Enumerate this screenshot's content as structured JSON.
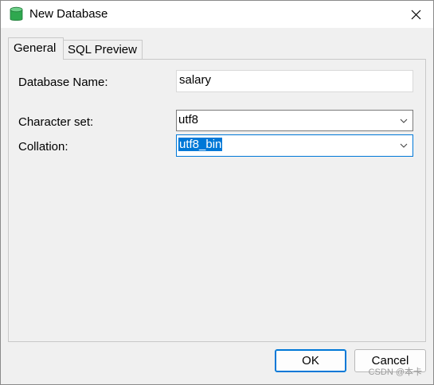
{
  "window": {
    "title": "New Database",
    "icon": "database-icon",
    "close_icon": "close-icon"
  },
  "tabs": [
    {
      "label": "General",
      "active": true
    },
    {
      "label": "SQL Preview",
      "active": false
    }
  ],
  "form": {
    "database_name_label": "Database Name:",
    "database_name_value": "salary",
    "character_set_label": "Character set:",
    "character_set_value": "utf8",
    "collation_label": "Collation:",
    "collation_value": "utf8_bin"
  },
  "buttons": {
    "ok_label": "OK",
    "cancel_label": "Cancel"
  },
  "watermark": "CSDN @本卡",
  "colors": {
    "accent": "#0078d7",
    "background": "#f0f0f0",
    "icon_green": "#2fa84f"
  }
}
